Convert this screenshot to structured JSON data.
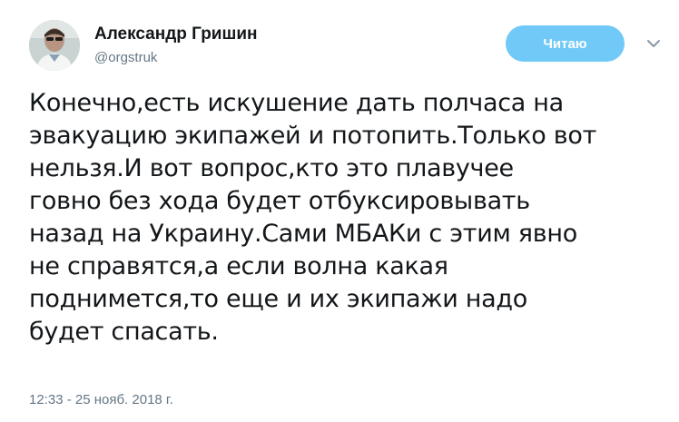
{
  "author": {
    "display_name": "Александр Гришин",
    "handle": "@orgstruk",
    "avatar": "user-avatar-photo"
  },
  "actions": {
    "follow_label": "Читаю",
    "menu_icon": "chevron-down-icon"
  },
  "tweet": {
    "lines": [
      "Конечно,есть искушение дать полчаса на",
      "эвакуацию экипажей и потопить.Только вот",
      "нельзя.И вот вопрос,кто это плавучее",
      "говно без хода будет отбуксировывать",
      "назад на Украину.Сами МБАКи с этим явно",
      "не справятся,а если волна какая",
      "поднимется,то еще и их экипажи надо",
      "будет спасать."
    ],
    "timestamp": "12:33 - 25 нояб. 2018 г."
  },
  "colors": {
    "follow_button_bg": "#71c9f8",
    "text": "#14171a",
    "secondary_text": "#657786"
  }
}
